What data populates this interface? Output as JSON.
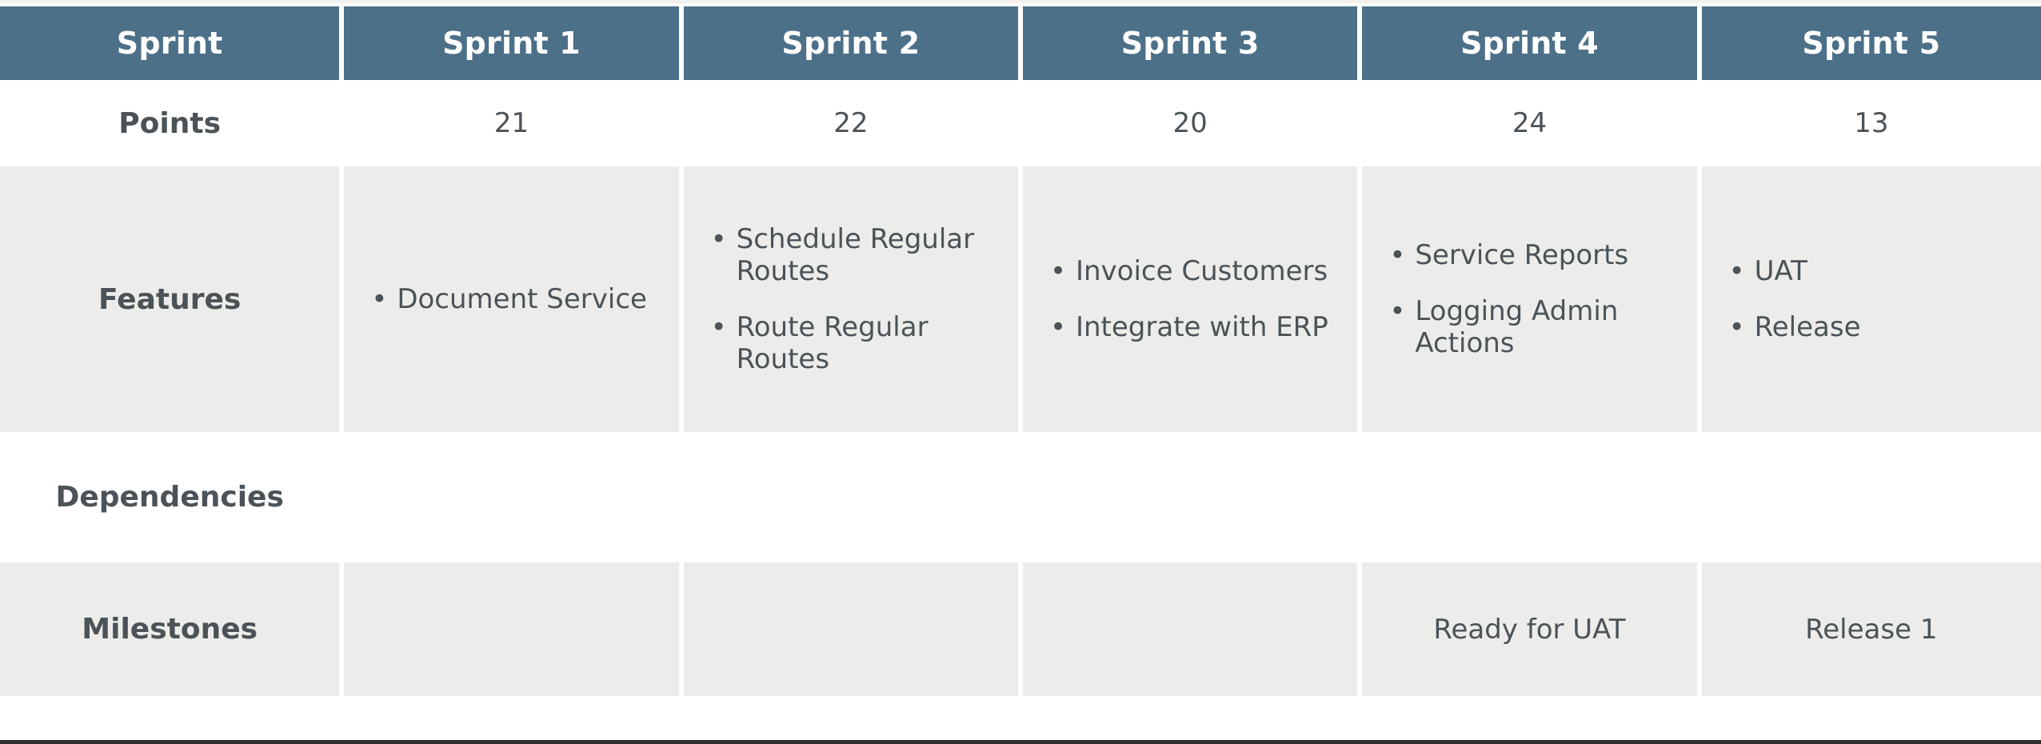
{
  "colors": {
    "header_bg": "#4d7089",
    "header_text": "#ffffff",
    "band_grey": "#ecedea",
    "band_white": "#ffffff",
    "body_text": "#4b5358"
  },
  "table": {
    "columns": [
      {
        "label": "Sprint"
      },
      {
        "label": "Sprint 1"
      },
      {
        "label": "Sprint 2"
      },
      {
        "label": "Sprint 3"
      },
      {
        "label": "Sprint 4"
      },
      {
        "label": "Sprint 5"
      }
    ],
    "rows": [
      {
        "label": "Points",
        "band": "white",
        "cells": [
          "21",
          "22",
          "20",
          "24",
          "13"
        ]
      },
      {
        "label": "Features",
        "band": "grey",
        "lists": [
          [
            "Document Service"
          ],
          [
            "Schedule Regular Routes",
            "Route Regular Routes"
          ],
          [
            "Invoice Customers",
            "Integrate with ERP"
          ],
          [
            "Service Reports",
            "Logging Admin Actions"
          ],
          [
            "UAT",
            "Release"
          ]
        ]
      },
      {
        "label": "Dependencies",
        "band": "white",
        "cells": [
          "",
          "",
          "",
          "",
          ""
        ]
      },
      {
        "label": "Milestones",
        "band": "grey",
        "cells": [
          "",
          "",
          "",
          "Ready for UAT",
          "Release 1"
        ]
      }
    ],
    "bullet_glyph": "•"
  }
}
